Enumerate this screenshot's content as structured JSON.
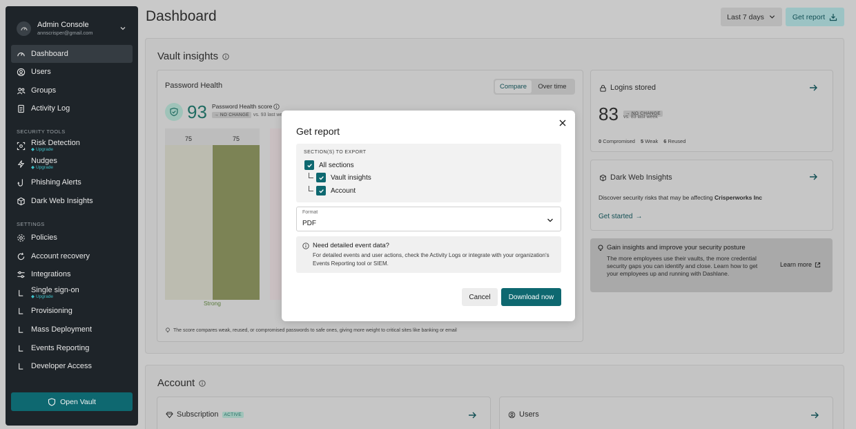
{
  "sidebar": {
    "account_name": "Admin Console",
    "account_email": "annscrisper@gmail.com",
    "items": [
      {
        "label": "Dashboard"
      },
      {
        "label": "Users"
      },
      {
        "label": "Groups"
      },
      {
        "label": "Activity Log"
      }
    ],
    "security_tools_heading": "SECURITY TOOLS",
    "security_tools": [
      {
        "label": "Risk Detection",
        "badge": "Upgrade"
      },
      {
        "label": "Nudges",
        "badge": "Upgrade"
      },
      {
        "label": "Phishing Alerts"
      },
      {
        "label": "Dark Web Insights"
      }
    ],
    "settings_heading": "SETTINGS",
    "settings": [
      {
        "label": "Policies"
      },
      {
        "label": "Account recovery"
      },
      {
        "label": "Integrations"
      },
      {
        "label": "Single sign-on",
        "badge": "Upgrade"
      },
      {
        "label": "Provisioning"
      },
      {
        "label": "Mass Deployment"
      },
      {
        "label": "Events Reporting"
      },
      {
        "label": "Developer Access"
      }
    ],
    "open_vault": "Open Vault"
  },
  "header": {
    "title": "Dashboard",
    "range": "Last 7 days",
    "get_report": "Get report"
  },
  "vault": {
    "title": "Vault insights",
    "health_title": "Password Health",
    "toggle_compare": "Compare",
    "toggle_overtime": "Over time",
    "score": "93",
    "score_label": "Password Health score",
    "no_change": "NO CHANGE",
    "score_vs": "vs. 93 last week",
    "bars": [
      75,
      75
    ],
    "bar_category": "Strong",
    "footnote": "The score compares weak, reused, or compromised passwords to safe ones, giving more weight to critical sites like banking or email"
  },
  "logins": {
    "title": "Logins stored",
    "count": "83",
    "no_change": "NO CHANGE",
    "vs": "vs. 83 last week",
    "compromised_n": "0",
    "compromised": "Compromised",
    "weak_n": "5",
    "weak": "Weak",
    "reused_n": "6",
    "reused": "Reused"
  },
  "darkweb": {
    "title": "Dark Web Insights",
    "desc": "Discover security risks that may be affecting",
    "company": "Crisperworks Inc",
    "cta": "Get started"
  },
  "tip": {
    "title": "Gain insights and improve your security posture",
    "body": "The more employees use their vaults, the more credential security gaps you can identify and close. Learn how to get your employees up and running with Dashlane.",
    "link": "Learn more"
  },
  "account": {
    "title": "Account",
    "subscription": "Subscription",
    "active": "ACTIVE",
    "users": "Users"
  },
  "modal": {
    "title": "Get report",
    "sections_heading": "SECTION(S) TO EXPORT",
    "all_sections": "All sections",
    "vault_insights": "Vault insights",
    "account": "Account",
    "format_label": "Format",
    "format_value": "PDF",
    "info_title": "Need detailed event data?",
    "info_text": "For detailed events and user actions, check the Activity Logs or integrate with your organization's Events Reporting tool or SIEM.",
    "cancel": "Cancel",
    "download": "Download now"
  },
  "colors": {
    "sidebar_bg": "#1e2429",
    "accent": "#0e6870",
    "bar_default": "#bcbcb0",
    "bar_current": "#7c8355"
  }
}
